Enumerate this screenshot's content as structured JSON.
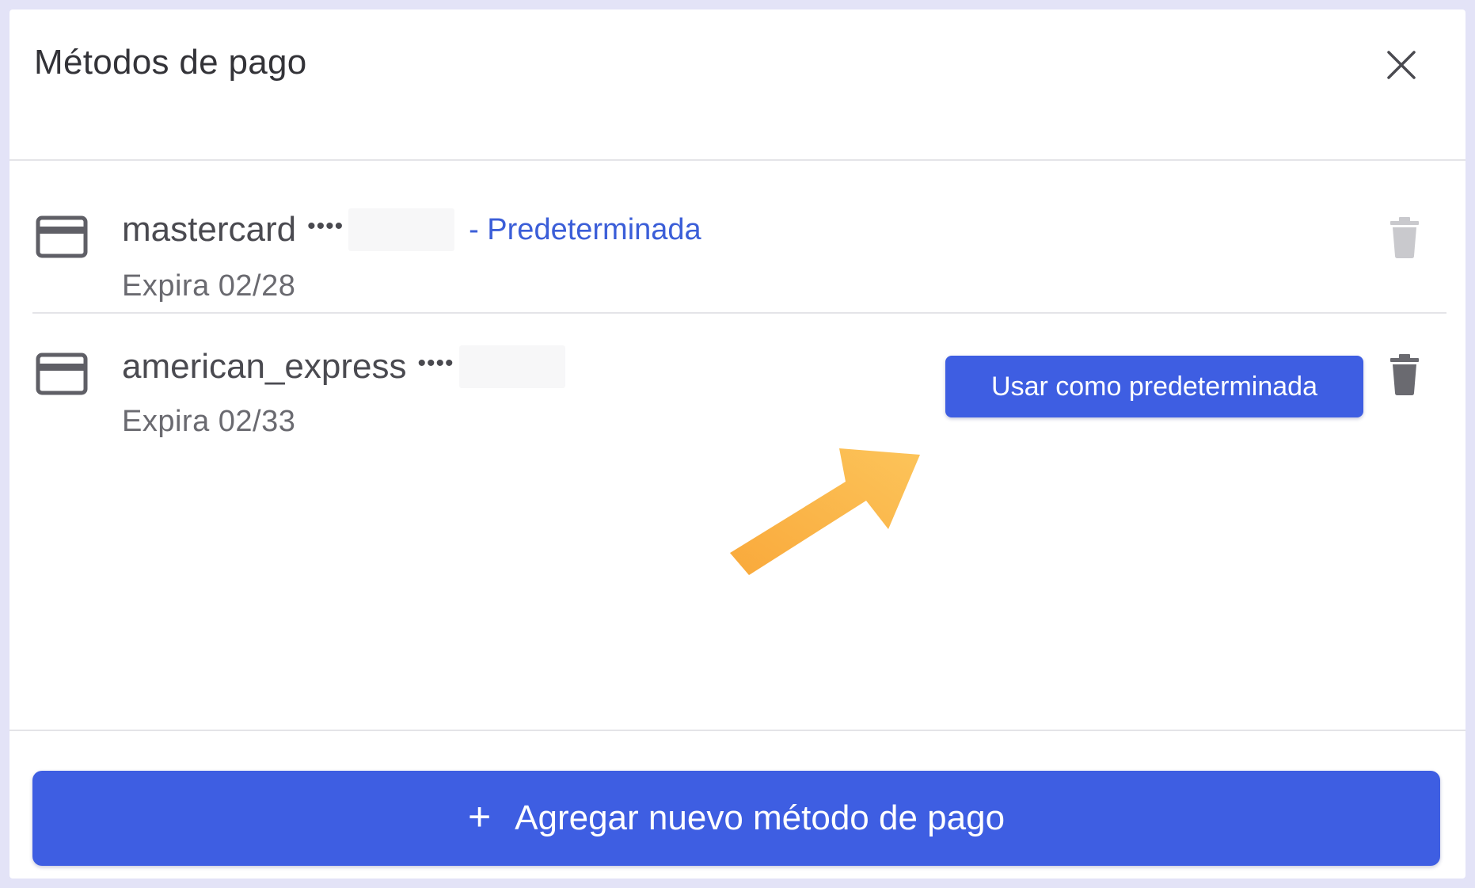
{
  "modal": {
    "title": "Métodos de pago"
  },
  "cards": [
    {
      "brand": "mastercard",
      "masked": "••••",
      "default_label": "- Predeterminada",
      "expiry": "Expira 02/28"
    },
    {
      "brand": "american_express",
      "masked": "••••",
      "expiry": "Expira 02/33",
      "use_default_label": "Usar como predeterminada"
    }
  ],
  "footer": {
    "add_label": "Agregar nuevo método de pago",
    "plus_symbol": "+"
  },
  "colors": {
    "accent": "#3e5ee2",
    "default_tag": "#3b5ed8",
    "annotation_arrow": "#f9a93b"
  },
  "icons": {
    "close": "close-icon",
    "card": "credit-card-icon",
    "delete": "trash-icon",
    "add": "plus-icon"
  }
}
